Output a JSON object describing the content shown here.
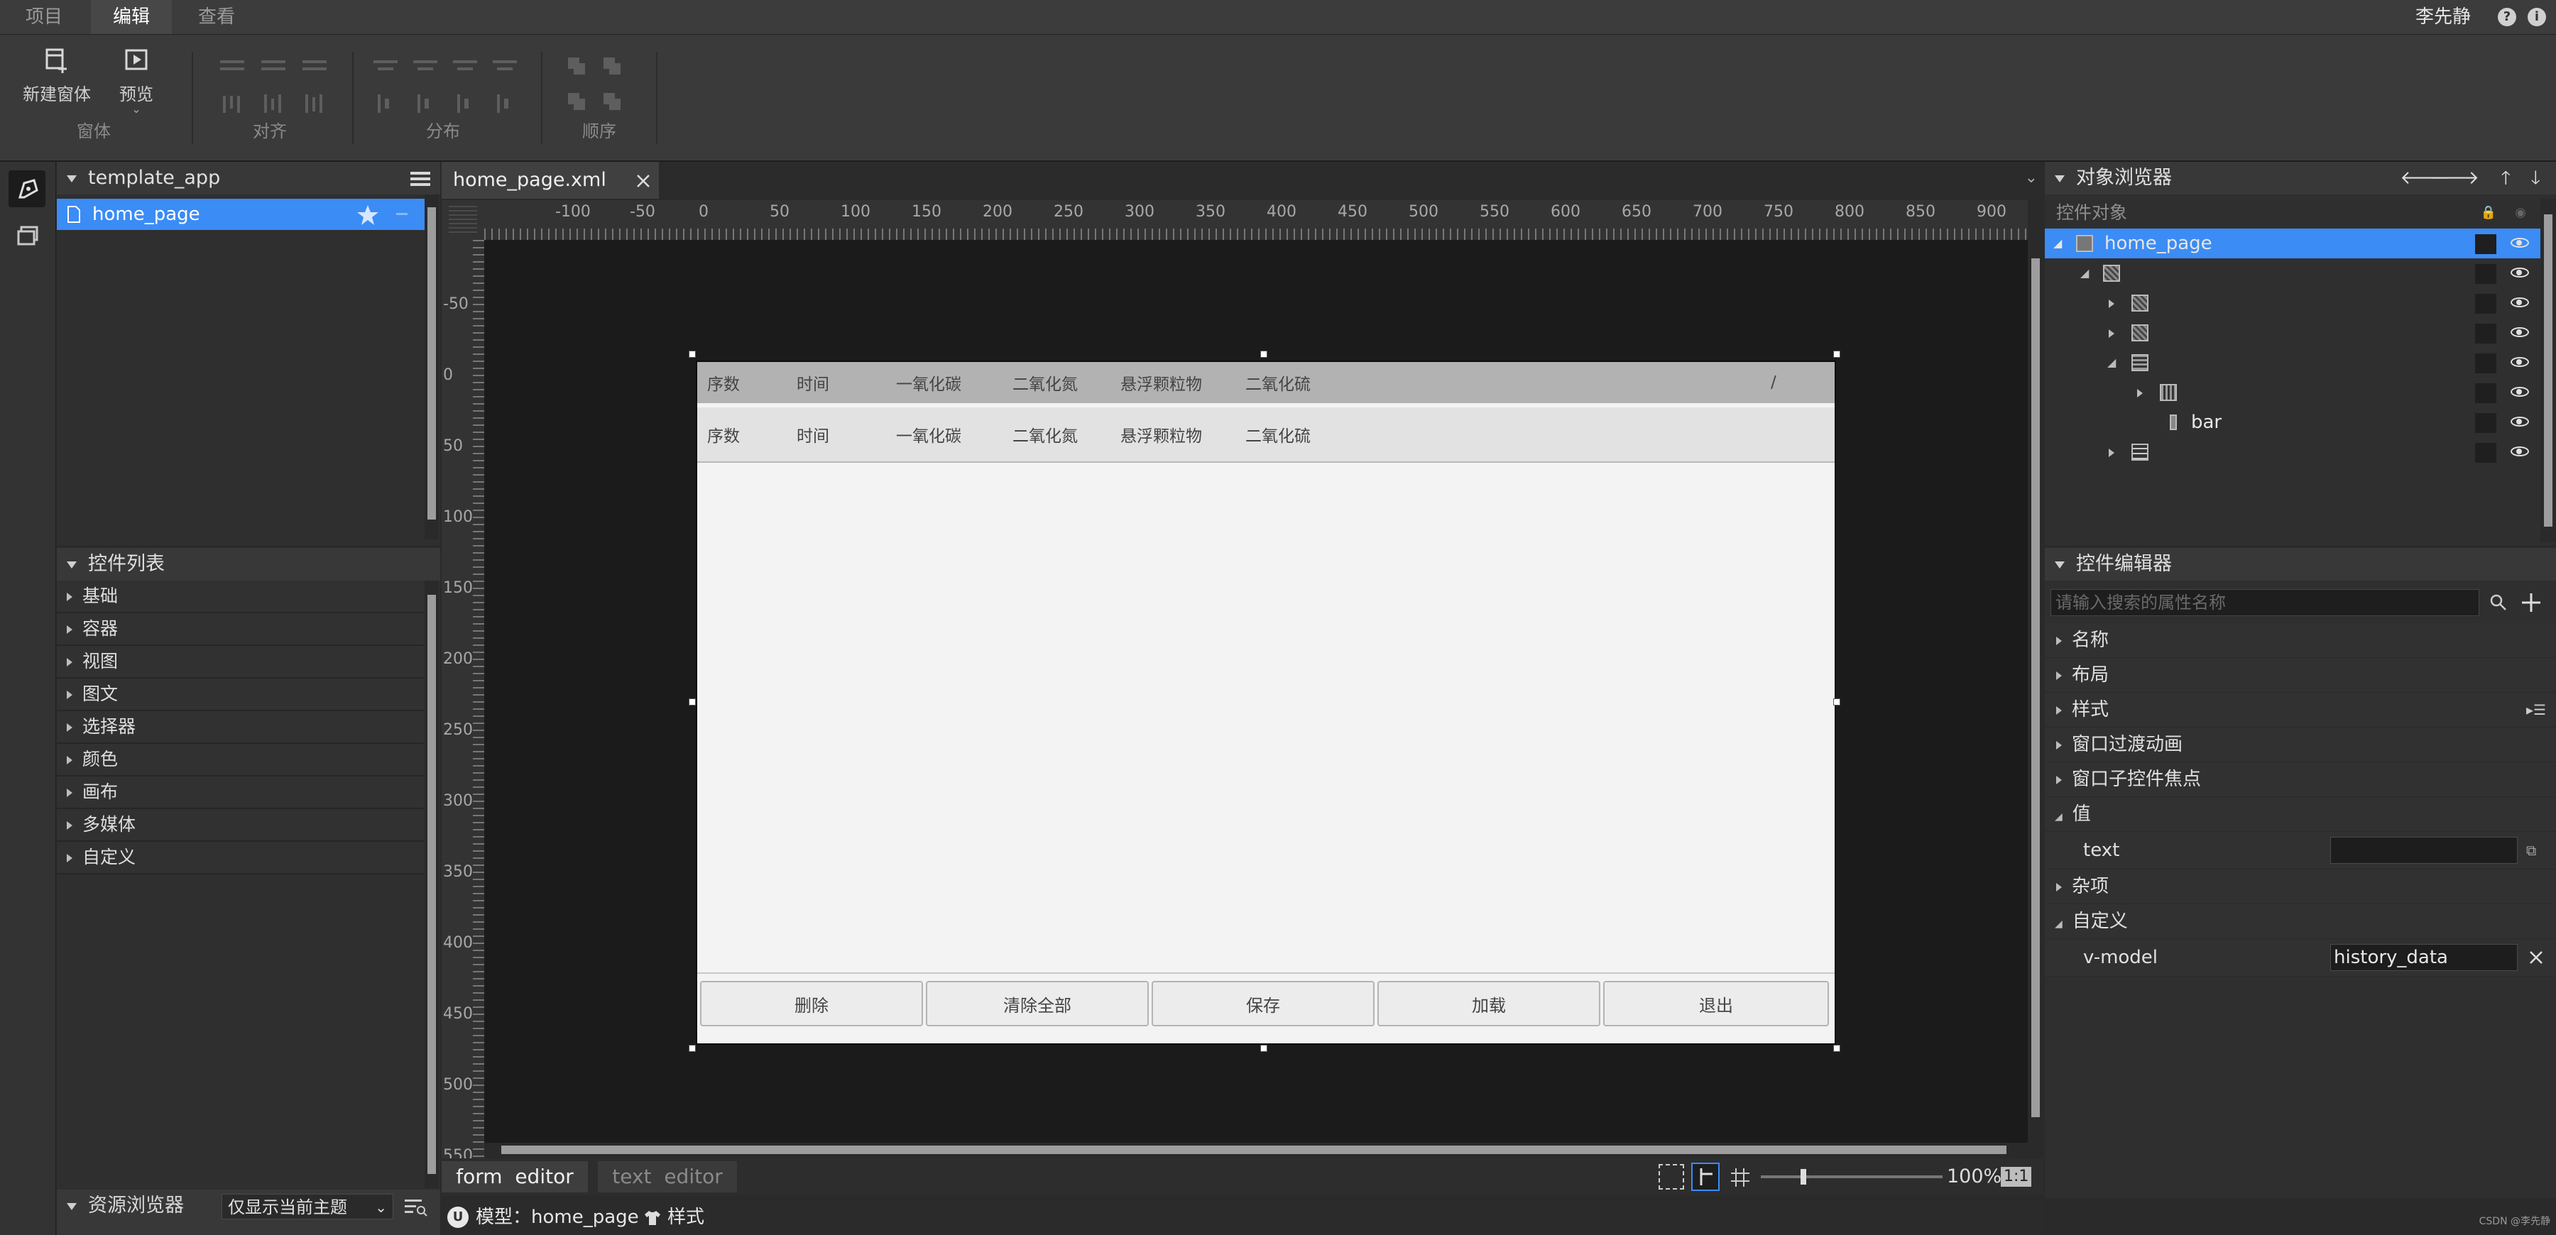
{
  "menubar": {
    "tabs": [
      {
        "label": "项目"
      },
      {
        "label": "编辑"
      },
      {
        "label": "查看"
      }
    ],
    "active_tab": "编辑",
    "user": "李先静",
    "help_icon": "?",
    "info_icon": "i"
  },
  "ribbon": {
    "new_window": "新建窗体",
    "preview": "预览",
    "groups": {
      "window": "窗体",
      "align": "对齐",
      "distribute": "分布",
      "order": "顺序"
    }
  },
  "project_panel": {
    "title": "template_app",
    "items": [
      {
        "label": "home_page"
      }
    ]
  },
  "widget_list": {
    "title": "控件列表",
    "items": [
      {
        "label": "基础"
      },
      {
        "label": "容器"
      },
      {
        "label": "视图"
      },
      {
        "label": "图文"
      },
      {
        "label": "选择器"
      },
      {
        "label": "颜色"
      },
      {
        "label": "画布"
      },
      {
        "label": "多媒体"
      },
      {
        "label": "自定义"
      }
    ]
  },
  "resource_browser": {
    "title": "资源浏览器",
    "filter": "仅显示当前主题"
  },
  "editor": {
    "tab": "home_page.xml",
    "ruler_h": [
      "-100",
      "-50",
      "0",
      "50",
      "100",
      "150",
      "200",
      "250",
      "300",
      "350",
      "400",
      "450",
      "500",
      "550",
      "600",
      "650",
      "700",
      "750",
      "800",
      "850",
      "900"
    ],
    "ruler_v": [
      "-50",
      "0",
      "50",
      "100",
      "150",
      "200",
      "250",
      "300",
      "350",
      "400",
      "450",
      "500",
      "550"
    ],
    "form": {
      "header_row": [
        "序数",
        "时间",
        "一氧化碳",
        "二氧化氮",
        "悬浮颗粒物",
        "二氧化硫"
      ],
      "header_slash": "/",
      "data_row": [
        "序数",
        "时间",
        "一氧化碳",
        "二氧化氮",
        "悬浮颗粒物",
        "二氧化硫"
      ],
      "buttons": [
        {
          "label": "删除"
        },
        {
          "label": "清除全部"
        },
        {
          "label": "保存"
        },
        {
          "label": "加载"
        },
        {
          "label": "退出"
        }
      ]
    },
    "bottom_tabs": {
      "form_editor": "form  editor",
      "text_editor": "text  editor"
    },
    "zoom": "100%",
    "ratio": "1:1"
  },
  "status": {
    "model": "模型：home_page",
    "style": "样式",
    "watermark": "CSDN @李先静"
  },
  "object_browser": {
    "title": "对象浏览器",
    "sub_header": "控件对象",
    "root": "home_page",
    "bar_label": "bar"
  },
  "widget_editor": {
    "title": "控件编辑器",
    "search_placeholder": "请输入搜索的属性名称",
    "sections": {
      "name": "名称",
      "layout": "布局",
      "style": "样式",
      "window_anim": "窗口过渡动画",
      "child_focus": "窗口子控件焦点",
      "value": "值",
      "misc": "杂项",
      "custom": "自定义"
    },
    "text_prop": "text",
    "text_value": "",
    "vmodel_prop": "v-model",
    "vmodel_value": "history_data"
  },
  "colors": {
    "accent": "#3b8cf5",
    "selected_bg": "#3b8cf5"
  }
}
